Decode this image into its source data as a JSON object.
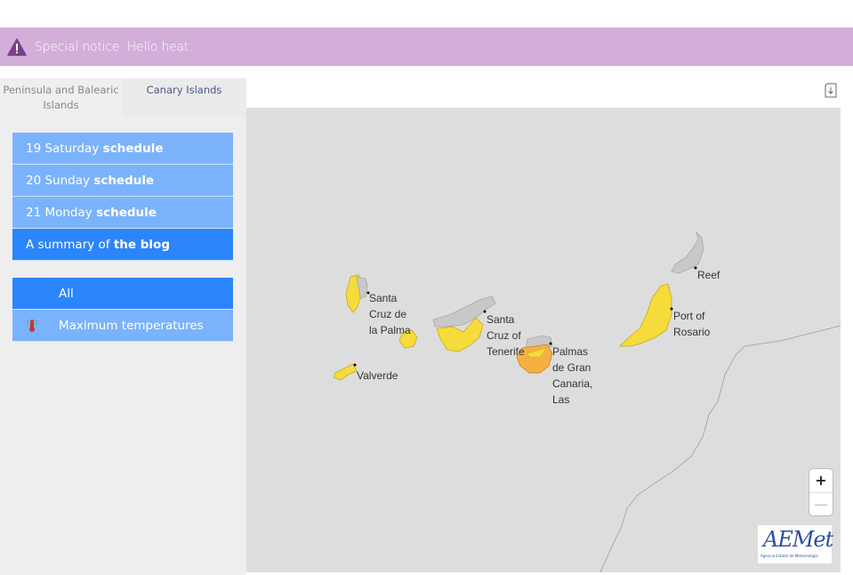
{
  "notice": {
    "text": "Special notice. Hello heat.",
    "icon": "warning-icon",
    "bg_color": "#d2aed9"
  },
  "tabs": [
    {
      "label": "Peninsula and Balearic Islands",
      "active": false
    },
    {
      "label": "Canary Islands",
      "active": true
    }
  ],
  "schedule_menu": [
    {
      "prefix": "19 Saturday ",
      "bold": "schedule",
      "active": false
    },
    {
      "prefix": "20 Sunday ",
      "bold": "schedule",
      "active": false
    },
    {
      "prefix": "21 Monday ",
      "bold": "schedule",
      "active": false
    },
    {
      "prefix": "A summary of ",
      "bold": "the blog",
      "active": true
    }
  ],
  "phenomena_menu": [
    {
      "label": "All",
      "active": true,
      "icon": null
    },
    {
      "label": "Maximum temperatures",
      "active": false,
      "icon": "thermometer-icon"
    }
  ],
  "toolbar": {
    "download_icon": "download-icon"
  },
  "map": {
    "labels": [
      {
        "id": "santa-cruz-de-la-palma",
        "text": "Santa\nCruz de\nla Palma"
      },
      {
        "id": "valverde",
        "text": "Valverde"
      },
      {
        "id": "santa-cruz-of-tenerife",
        "text": "Santa\nCruz of\nTenerife"
      },
      {
        "id": "palmas-de-gran-canaria",
        "text": "Palmas\nde Gran\nCanaria,\nLas"
      },
      {
        "id": "reef",
        "text": "Reef"
      },
      {
        "id": "port-of-rosario",
        "text": "Port of\nRosario"
      }
    ],
    "warning_colors": {
      "yellow": "#f5dc3b",
      "orange": "#f5b043",
      "none": "#c8c8c8"
    },
    "zoom_in": "+",
    "zoom_out": "—",
    "logo_text": "AEMet",
    "logo_subtext": "Agencia Estatal de Meteorología"
  }
}
